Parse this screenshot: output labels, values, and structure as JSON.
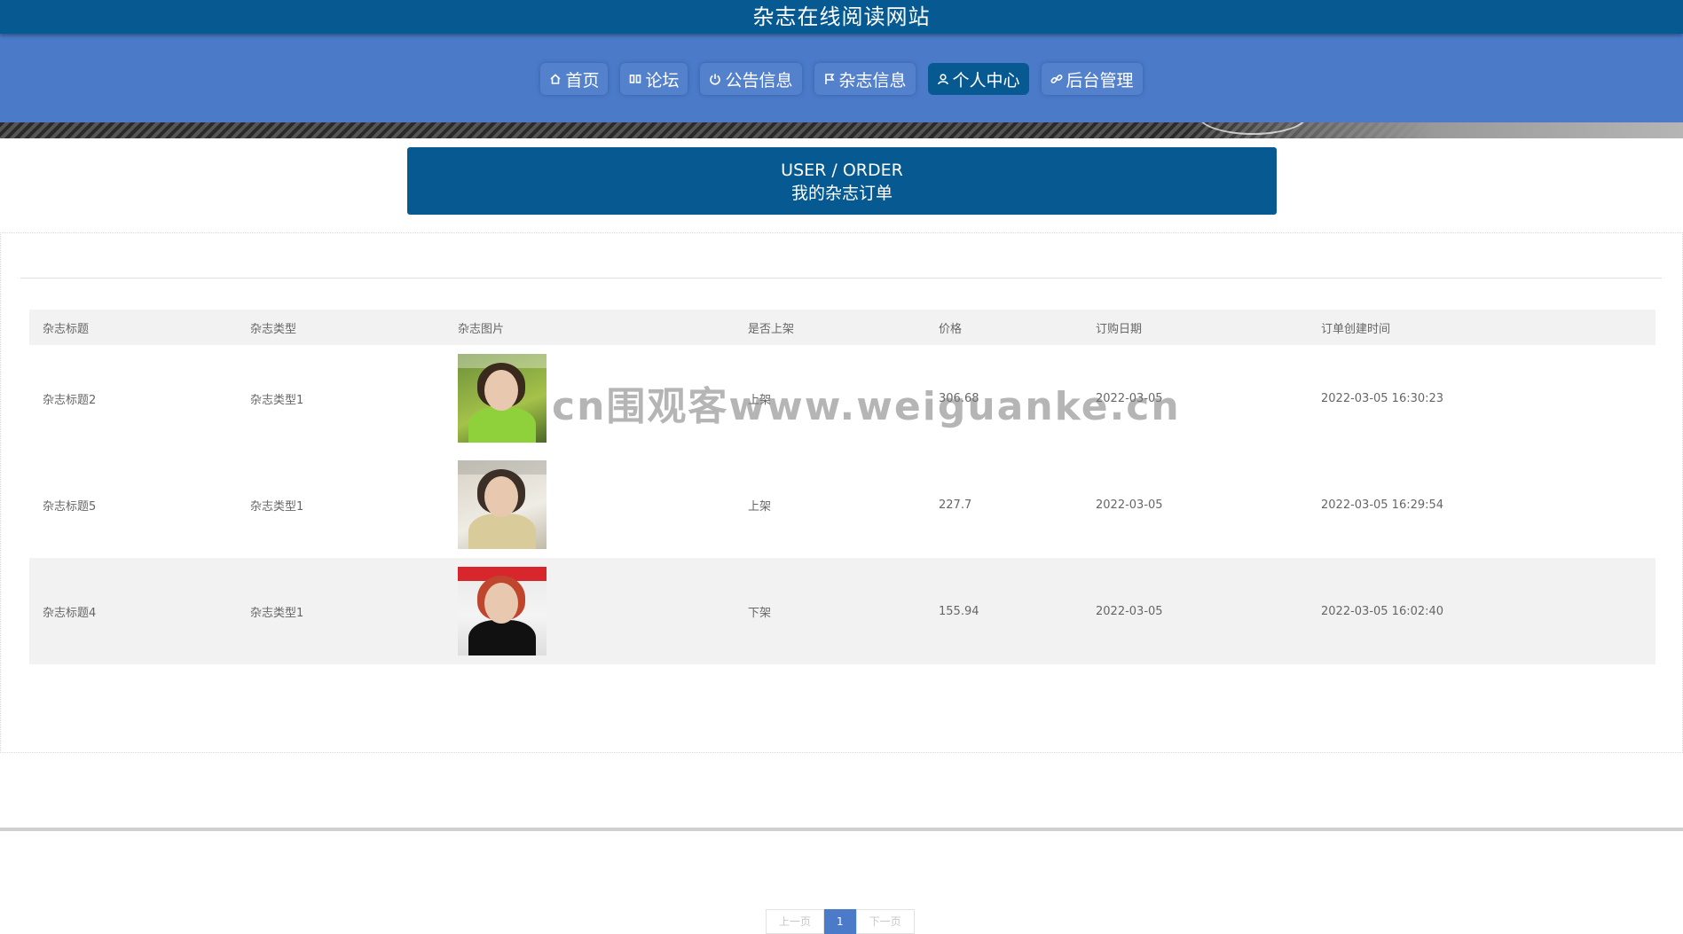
{
  "header": {
    "title": "杂志在线阅读网站"
  },
  "nav": [
    {
      "label": "首页",
      "icon": "home-icon",
      "active": false
    },
    {
      "label": "论坛",
      "icon": "forum-icon",
      "active": false
    },
    {
      "label": "公告信息",
      "icon": "power-icon",
      "active": false
    },
    {
      "label": "杂志信息",
      "icon": "flag-icon",
      "active": false
    },
    {
      "label": "个人中心",
      "icon": "user-icon",
      "active": true
    },
    {
      "label": "后台管理",
      "icon": "link-icon",
      "active": false
    }
  ],
  "banner": {
    "en": "USER / ORDER",
    "zh": "我的杂志订单"
  },
  "table": {
    "headers": [
      "杂志标题",
      "杂志类型",
      "杂志图片",
      "是否上架",
      "价格",
      "订购日期",
      "订单创建时间"
    ],
    "rows": [
      {
        "title": "杂志标题2",
        "type": "杂志类型1",
        "status": "上架",
        "price": "306.68",
        "date": "2022-03-05",
        "created": "2022-03-05 16:30:23"
      },
      {
        "title": "杂志标题5",
        "type": "杂志类型1",
        "status": "上架",
        "price": "227.7",
        "date": "2022-03-05",
        "created": "2022-03-05 16:29:54"
      },
      {
        "title": "杂志标题4",
        "type": "杂志类型1",
        "status": "下架",
        "price": "155.94",
        "date": "2022-03-05",
        "created": "2022-03-05 16:02:40"
      }
    ]
  },
  "pager": {
    "prev": "上一页",
    "current": "1",
    "next": "下一页"
  },
  "watermark": "cn围观客www.weiguanke.cn",
  "colors": {
    "topbar": "#075a91",
    "navband": "#4a7ac8",
    "active": "#075a91"
  }
}
